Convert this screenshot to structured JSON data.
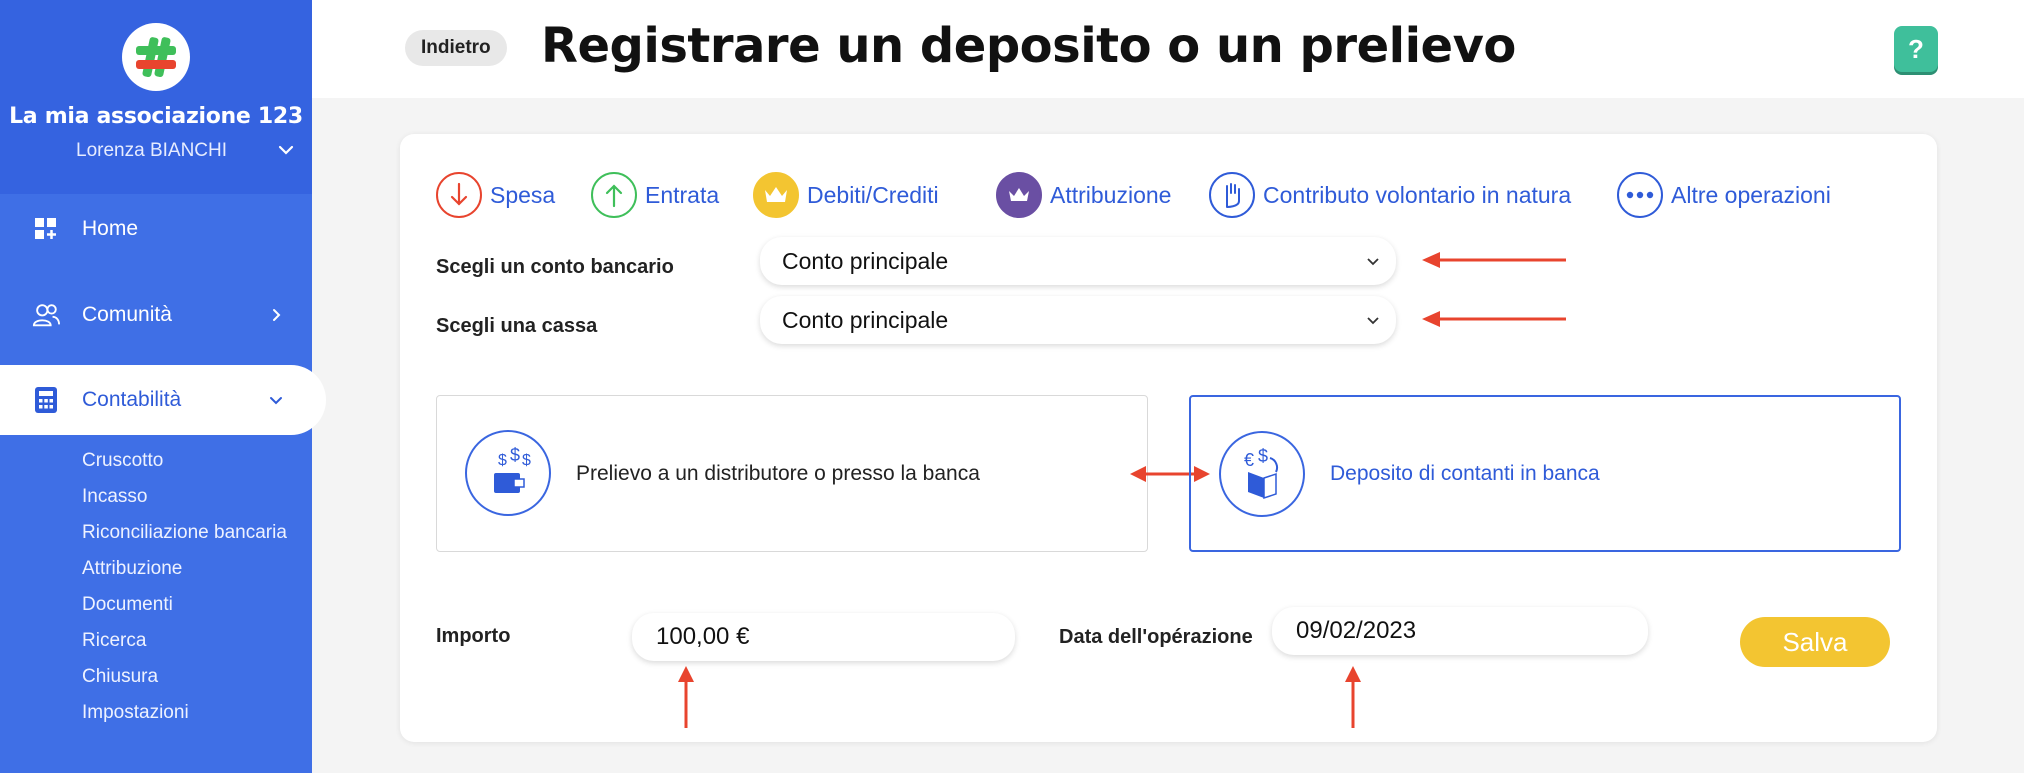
{
  "sidebar": {
    "org_name": "La mia associazione 123",
    "user_name": "Lorenza BIANCHI",
    "nav": {
      "home": "Home",
      "community": "Comunità",
      "accounting": "Contabilità"
    },
    "subnav": [
      "Cruscotto",
      "Incasso",
      "Riconciliazione bancaria",
      "Attribuzione",
      "Documenti",
      "Ricerca",
      "Chiusura",
      "Impostazioni"
    ]
  },
  "header": {
    "back_label": "Indietro",
    "title": "Registrare un deposito o un prelievo",
    "help_label": "?"
  },
  "tabs": {
    "expense": "Spesa",
    "income": "Entrata",
    "debts": "Debiti/Crediti",
    "attribution": "Attribuzione",
    "in_kind": "Contributo volontario in natura",
    "other": "Altre operazioni"
  },
  "form": {
    "bank_account_label": "Scegli un conto bancario",
    "bank_account_value": "Conto principale",
    "cash_label": "Scegli una cassa",
    "cash_value": "Conto principale",
    "option_withdrawal": "Prelievo a un distributore o presso la banca",
    "option_deposit": "Deposito di contanti in banca",
    "amount_label": "Importo",
    "amount_value": "100,00 €",
    "date_label": "Data dell'opérazione",
    "date_value": "09/02/2023",
    "save_label": "Salva"
  },
  "colors": {
    "sidebar": "#3f6fe6",
    "accent": "#2f5bd8",
    "save": "#f3c531",
    "help": "#3fbf9b",
    "annotation_arrow": "#e8442e"
  }
}
